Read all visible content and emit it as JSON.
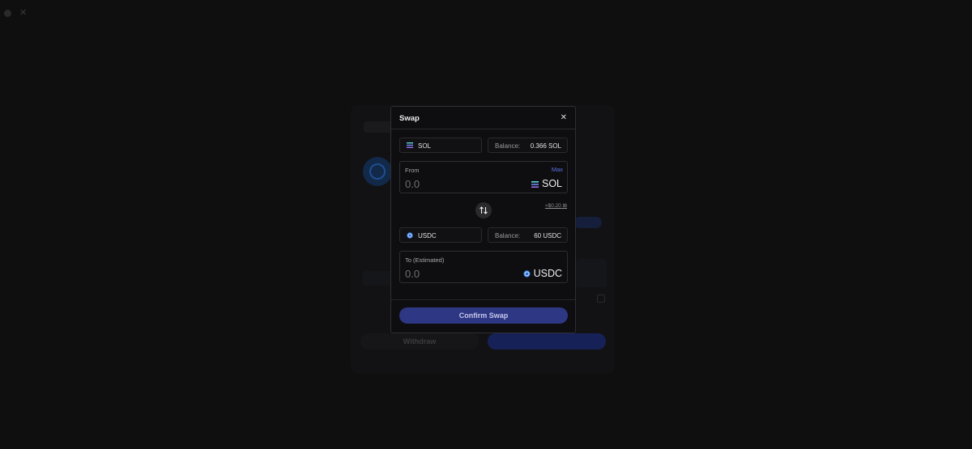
{
  "modal": {
    "title": "Swap",
    "from_token": {
      "symbol": "SOL",
      "icon": "solana-icon"
    },
    "from_balance_label": "Balance:",
    "from_balance_value": "0.366 SOL",
    "from_field_label": "From",
    "max_label": "Max",
    "from_amount": "0.0",
    "from_unit": "SOL",
    "usd_estimate": "≈$0.20",
    "to_token": {
      "symbol": "USDC",
      "icon": "usdc-icon"
    },
    "to_balance_label": "Balance:",
    "to_balance_value": "60 USDC",
    "to_field_label": "To (Estimated)",
    "to_amount": "0.0",
    "to_unit": "USDC",
    "confirm_label": "Confirm Swap"
  },
  "background": {
    "withdraw_label": "Withdraw"
  },
  "colors": {
    "accent": "#5b74e6",
    "confirm_button": "#2e3784",
    "modal_bg": "#0e0e10",
    "page_bg": "#0f0f10"
  }
}
